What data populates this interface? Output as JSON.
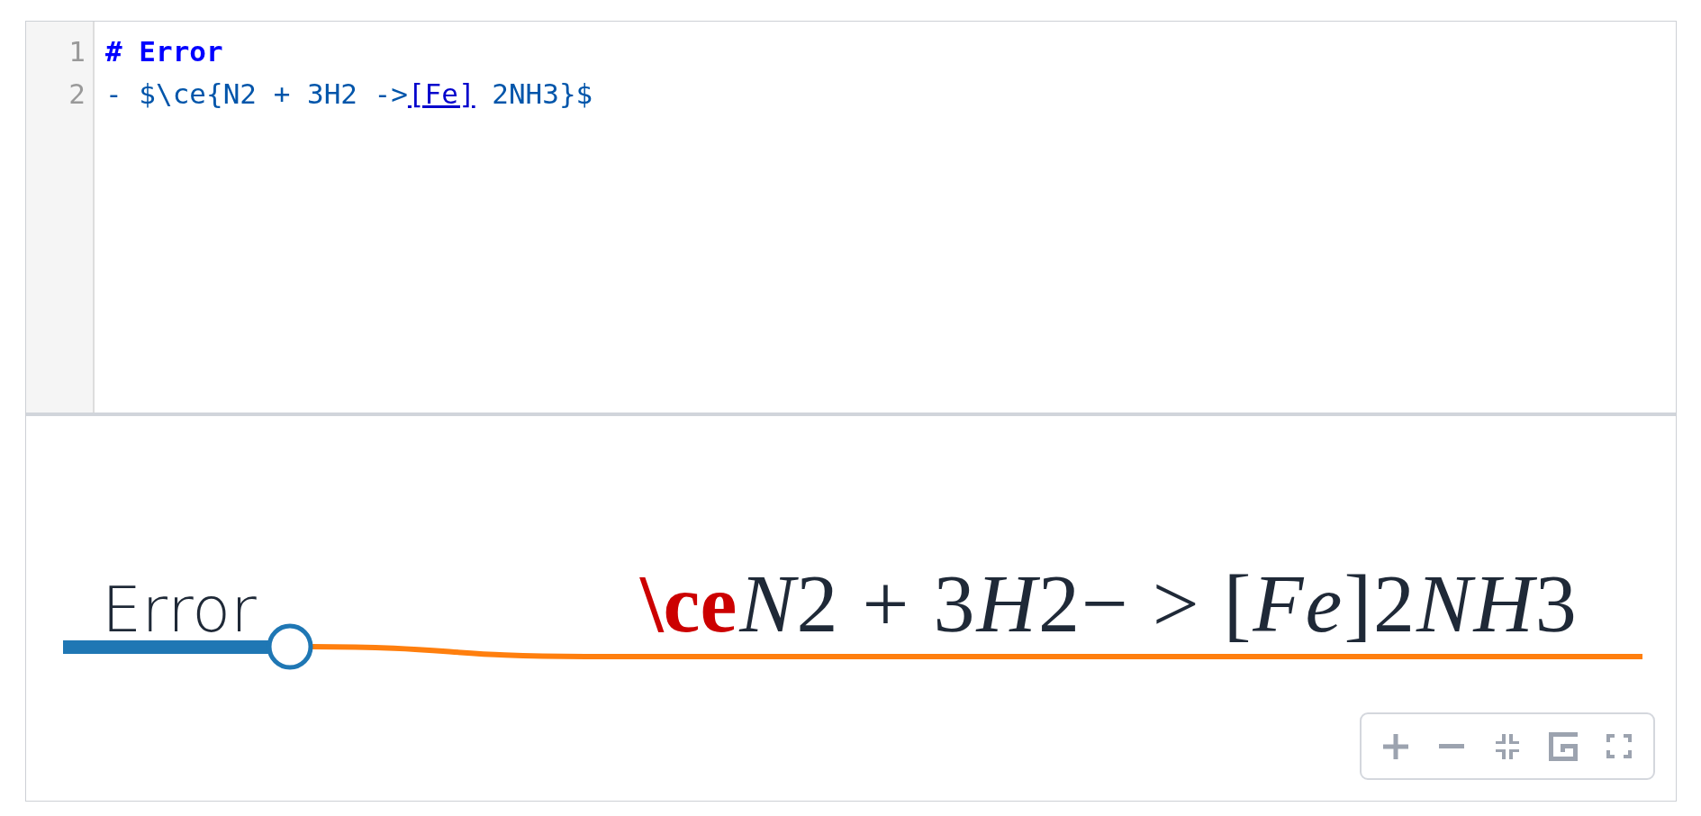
{
  "editor": {
    "lines": [
      {
        "number": "1",
        "tokens": [
          {
            "kind": "header",
            "text": "# Error"
          }
        ]
      },
      {
        "number": "2",
        "tokens": [
          {
            "kind": "text",
            "text": "- $\\ce{N2 + 3H2 ->"
          },
          {
            "kind": "link",
            "text": "[Fe]"
          },
          {
            "kind": "text",
            "text": " 2NH3}$"
          }
        ]
      }
    ]
  },
  "mindmap": {
    "root": {
      "label": "Error",
      "color": "#1f77b4",
      "expanded": true,
      "children": [
        {
          "color": "#ff7f0e",
          "label_parts": [
            {
              "kind": "error",
              "text": "\\ce"
            },
            {
              "kind": "math",
              "text": "N2 + 3H2− > [Fe]2NH3"
            }
          ]
        }
      ]
    }
  },
  "toolbar": {
    "buttons": [
      {
        "kind": "zoom_in"
      },
      {
        "kind": "zoom_out"
      },
      {
        "kind": "fit"
      },
      {
        "kind": "recurse"
      },
      {
        "kind": "fullscreen"
      }
    ]
  }
}
